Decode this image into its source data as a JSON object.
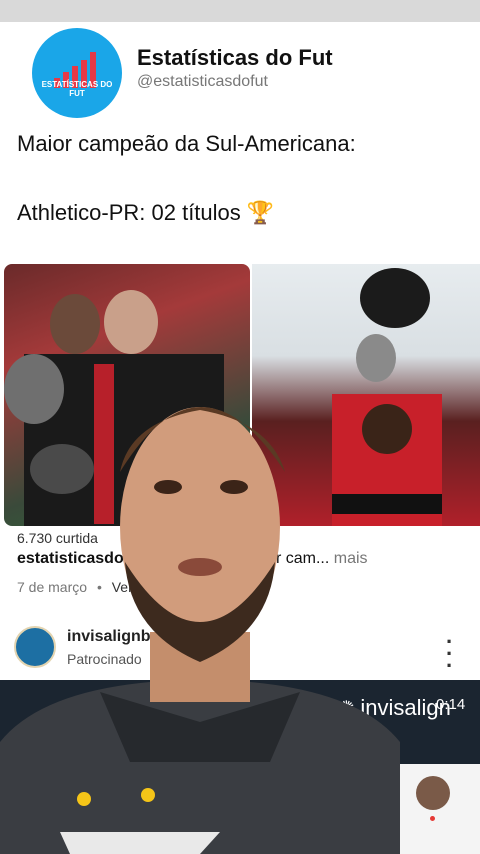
{
  "profile": {
    "name": "Estatísticas do Fut",
    "handle": "@estatisticasdofut",
    "avatar_text": "ESTATÍSTICAS DO FUT"
  },
  "post": {
    "line1": "Maior campeão da Sul-Americana:",
    "line2": "Athletico-PR: 02 títulos",
    "trophy_icon": "🏆"
  },
  "feed": {
    "truncated_line": "6.730 curtida",
    "caption_user": "estatisticasdof",
    "caption_text": "o maior cam...",
    "more_label": "mais",
    "date": "7 de março",
    "date_sep": "•",
    "translate_label": "Ver"
  },
  "ad": {
    "name": "invisalignbr",
    "label": "Patrocinado",
    "brand": "invisalign",
    "time": "0:14"
  },
  "colors": {
    "accent": "#1aa6e8",
    "video_bg": "#1b2530"
  }
}
